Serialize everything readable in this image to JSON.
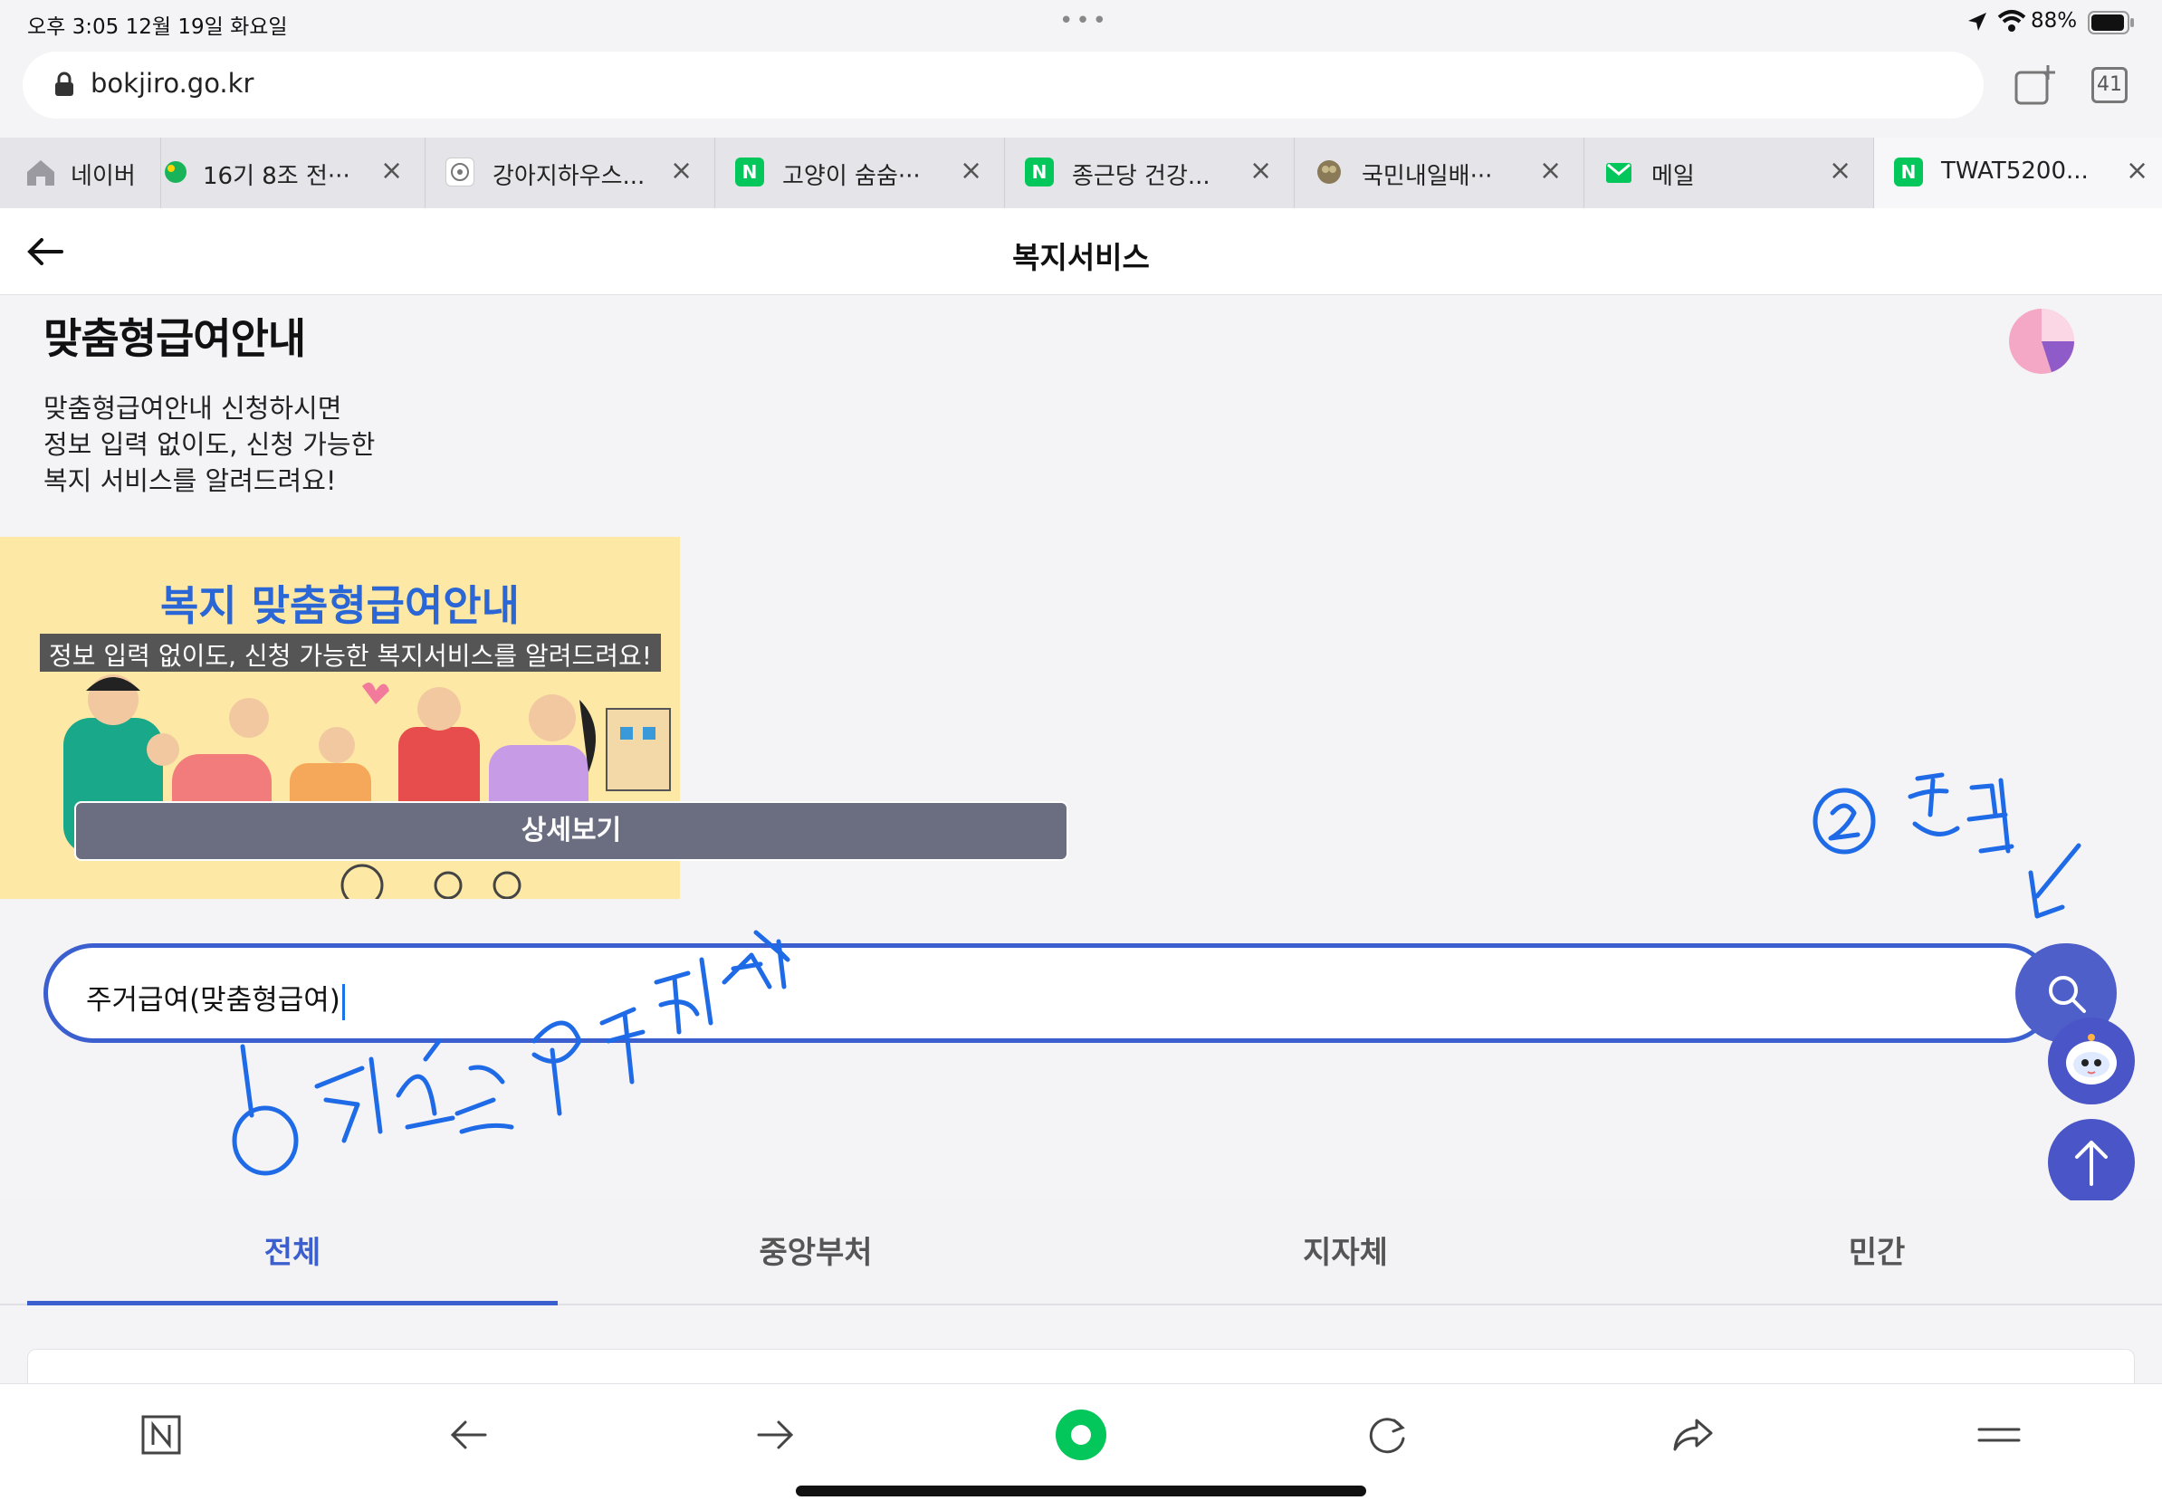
{
  "status_bar": {
    "time_date": "오후 3:05   12월 19일 화요일",
    "battery": "88%"
  },
  "browser": {
    "url": "bokjiro.go.kr",
    "tab_count": "41",
    "tabs": [
      {
        "label": "네이버"
      },
      {
        "label": "16기 8조 전···"
      },
      {
        "label": "강아지하우스..."
      },
      {
        "label": "고양이 숨숨···"
      },
      {
        "label": "종근당 건강..."
      },
      {
        "label": "국민내일배···"
      },
      {
        "label": "메일"
      },
      {
        "label": "TWAT5200..."
      }
    ]
  },
  "header": {
    "title": "복지서비스"
  },
  "intro": {
    "title": "맞춤형급여안내",
    "desc_line1": "맞춤형급여안내 신청하시면",
    "desc_line2": "정보 입력 없이도, 신청 가능한",
    "desc_line3": "복지 서비스를 알려드려요!"
  },
  "banner": {
    "title": "복지 맞춤형급여안내",
    "subtitle": "정보 입력 없이도, 신청 가능한 복지서비스를 알려드려요!",
    "detail_button": "상세보기"
  },
  "search": {
    "value": "주거급여(맞춤형급여)"
  },
  "category_tabs": [
    {
      "label": "전체",
      "active": true
    },
    {
      "label": "중앙부처",
      "active": false
    },
    {
      "label": "지자체",
      "active": false
    },
    {
      "label": "민간",
      "active": false
    }
  ],
  "colors": {
    "accent": "#3b5fcf",
    "annotation": "#1f6ae6",
    "naver_green": "#03c75a"
  }
}
